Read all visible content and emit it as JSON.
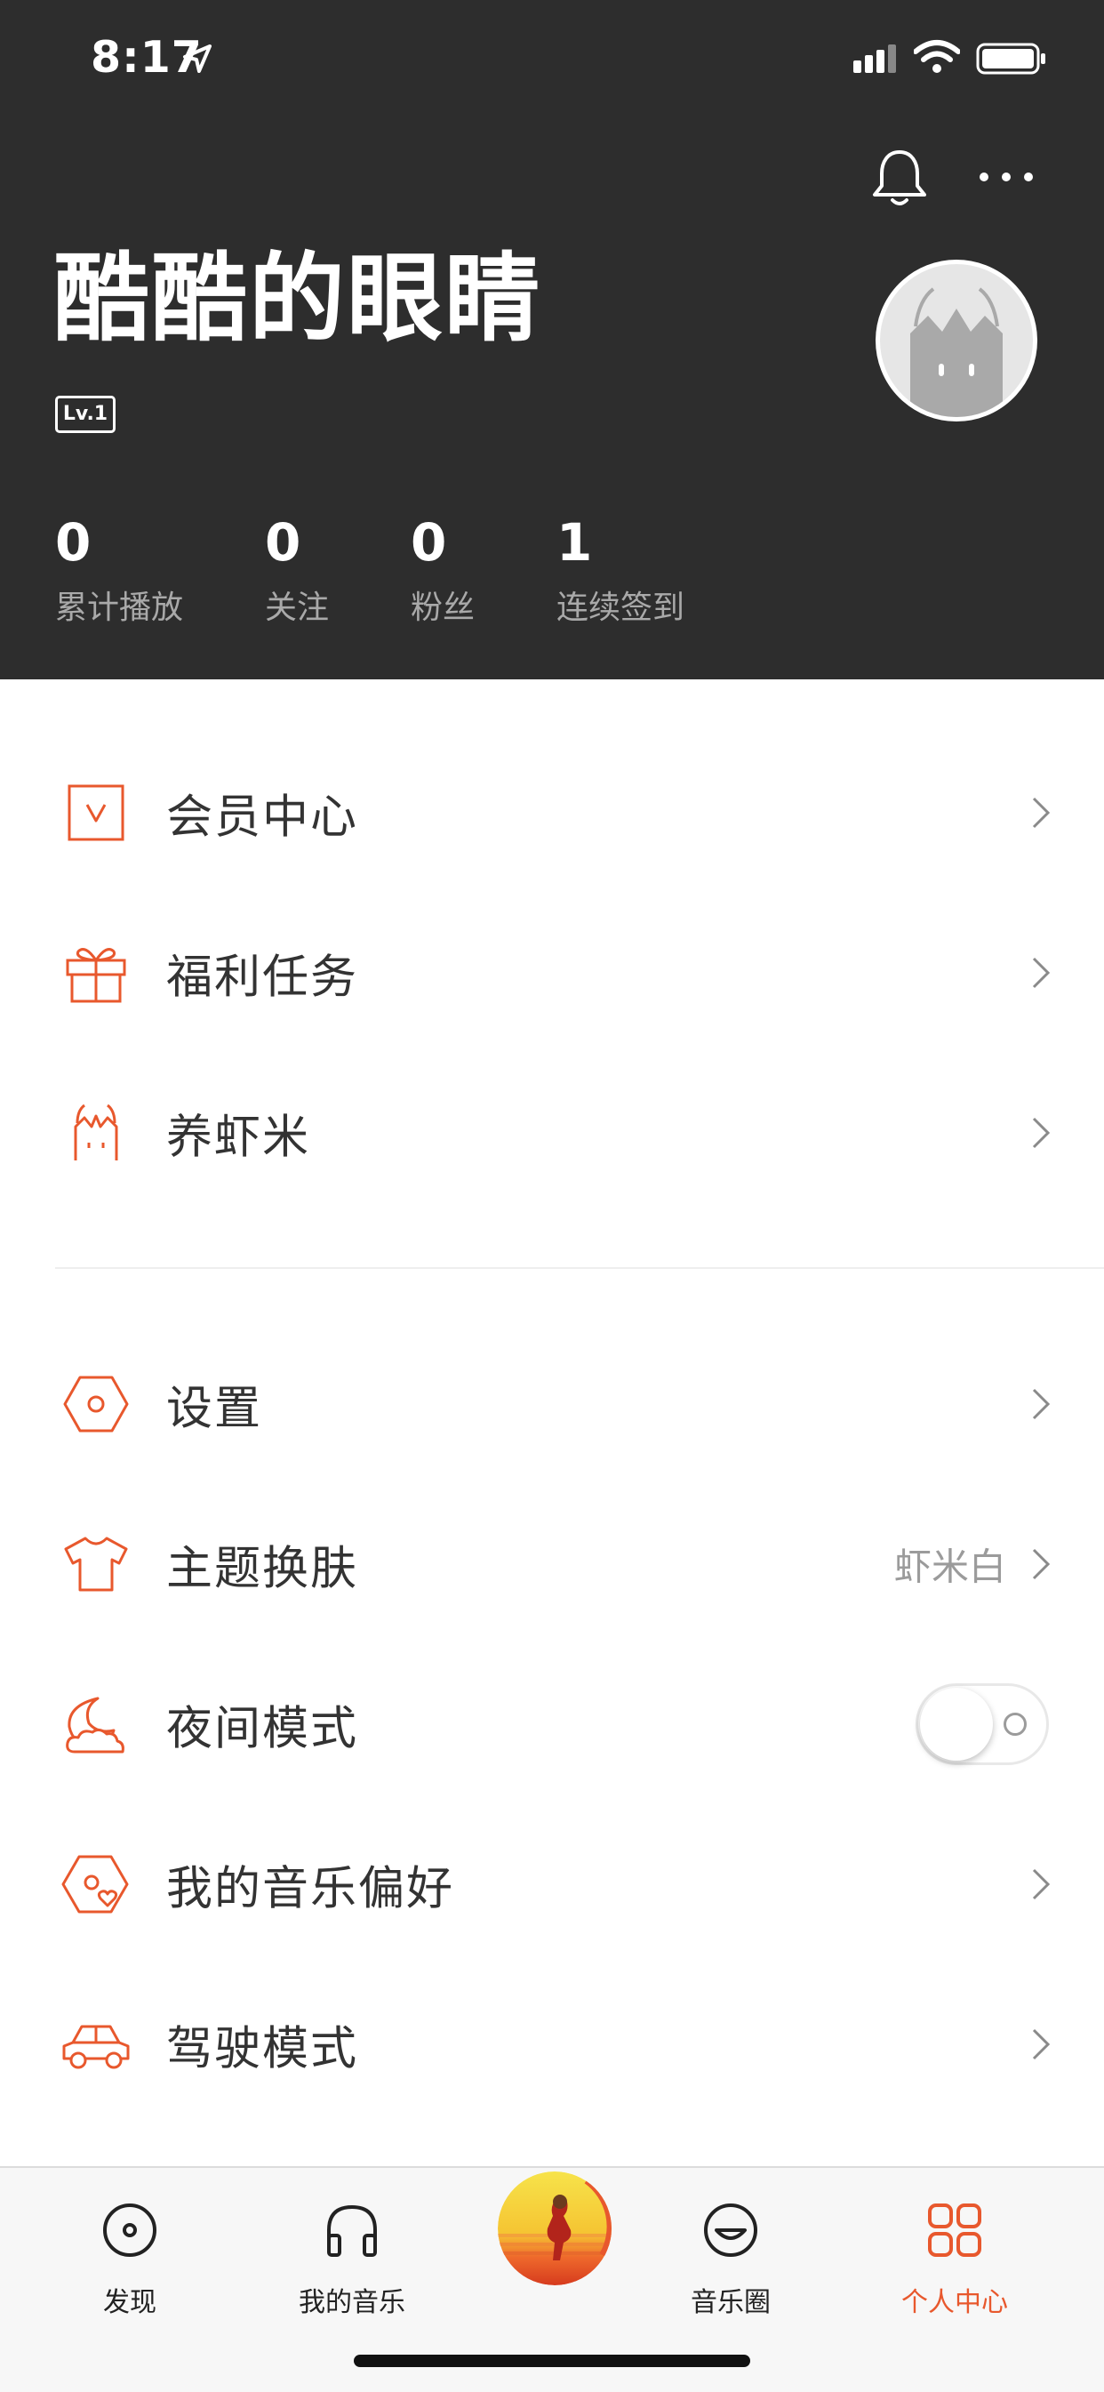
{
  "status": {
    "time": "8:17"
  },
  "profile": {
    "name": "酷酷的眼睛",
    "level": "Lv.1",
    "stats": [
      {
        "value": "0",
        "label": "累计播放"
      },
      {
        "value": "0",
        "label": "关注"
      },
      {
        "value": "0",
        "label": "粉丝"
      },
      {
        "value": "1",
        "label": "连续签到"
      }
    ]
  },
  "menu": {
    "group1": [
      {
        "label": "会员中心",
        "icon": "vip-icon"
      },
      {
        "label": "福利任务",
        "icon": "gift-icon"
      },
      {
        "label": "养虾米",
        "icon": "pet-icon"
      }
    ],
    "group2": [
      {
        "label": "设置",
        "icon": "settings-icon"
      },
      {
        "label": "主题换肤",
        "icon": "tshirt-icon",
        "value": "虾米白"
      },
      {
        "label": "夜间模式",
        "icon": "moon-icon",
        "toggle": false
      },
      {
        "label": "我的音乐偏好",
        "icon": "music-preference-icon"
      },
      {
        "label": "驾驶模式",
        "icon": "car-icon"
      }
    ]
  },
  "tabs": [
    {
      "label": "发现",
      "icon": "discover-icon"
    },
    {
      "label": "我的音乐",
      "icon": "headphones-icon"
    },
    {
      "label": "音乐圈",
      "icon": "smile-icon"
    },
    {
      "label": "个人中心",
      "icon": "grid-icon",
      "active": true
    }
  ],
  "colors": {
    "accent": "#e8582d",
    "header_bg": "#2d2d2d"
  }
}
